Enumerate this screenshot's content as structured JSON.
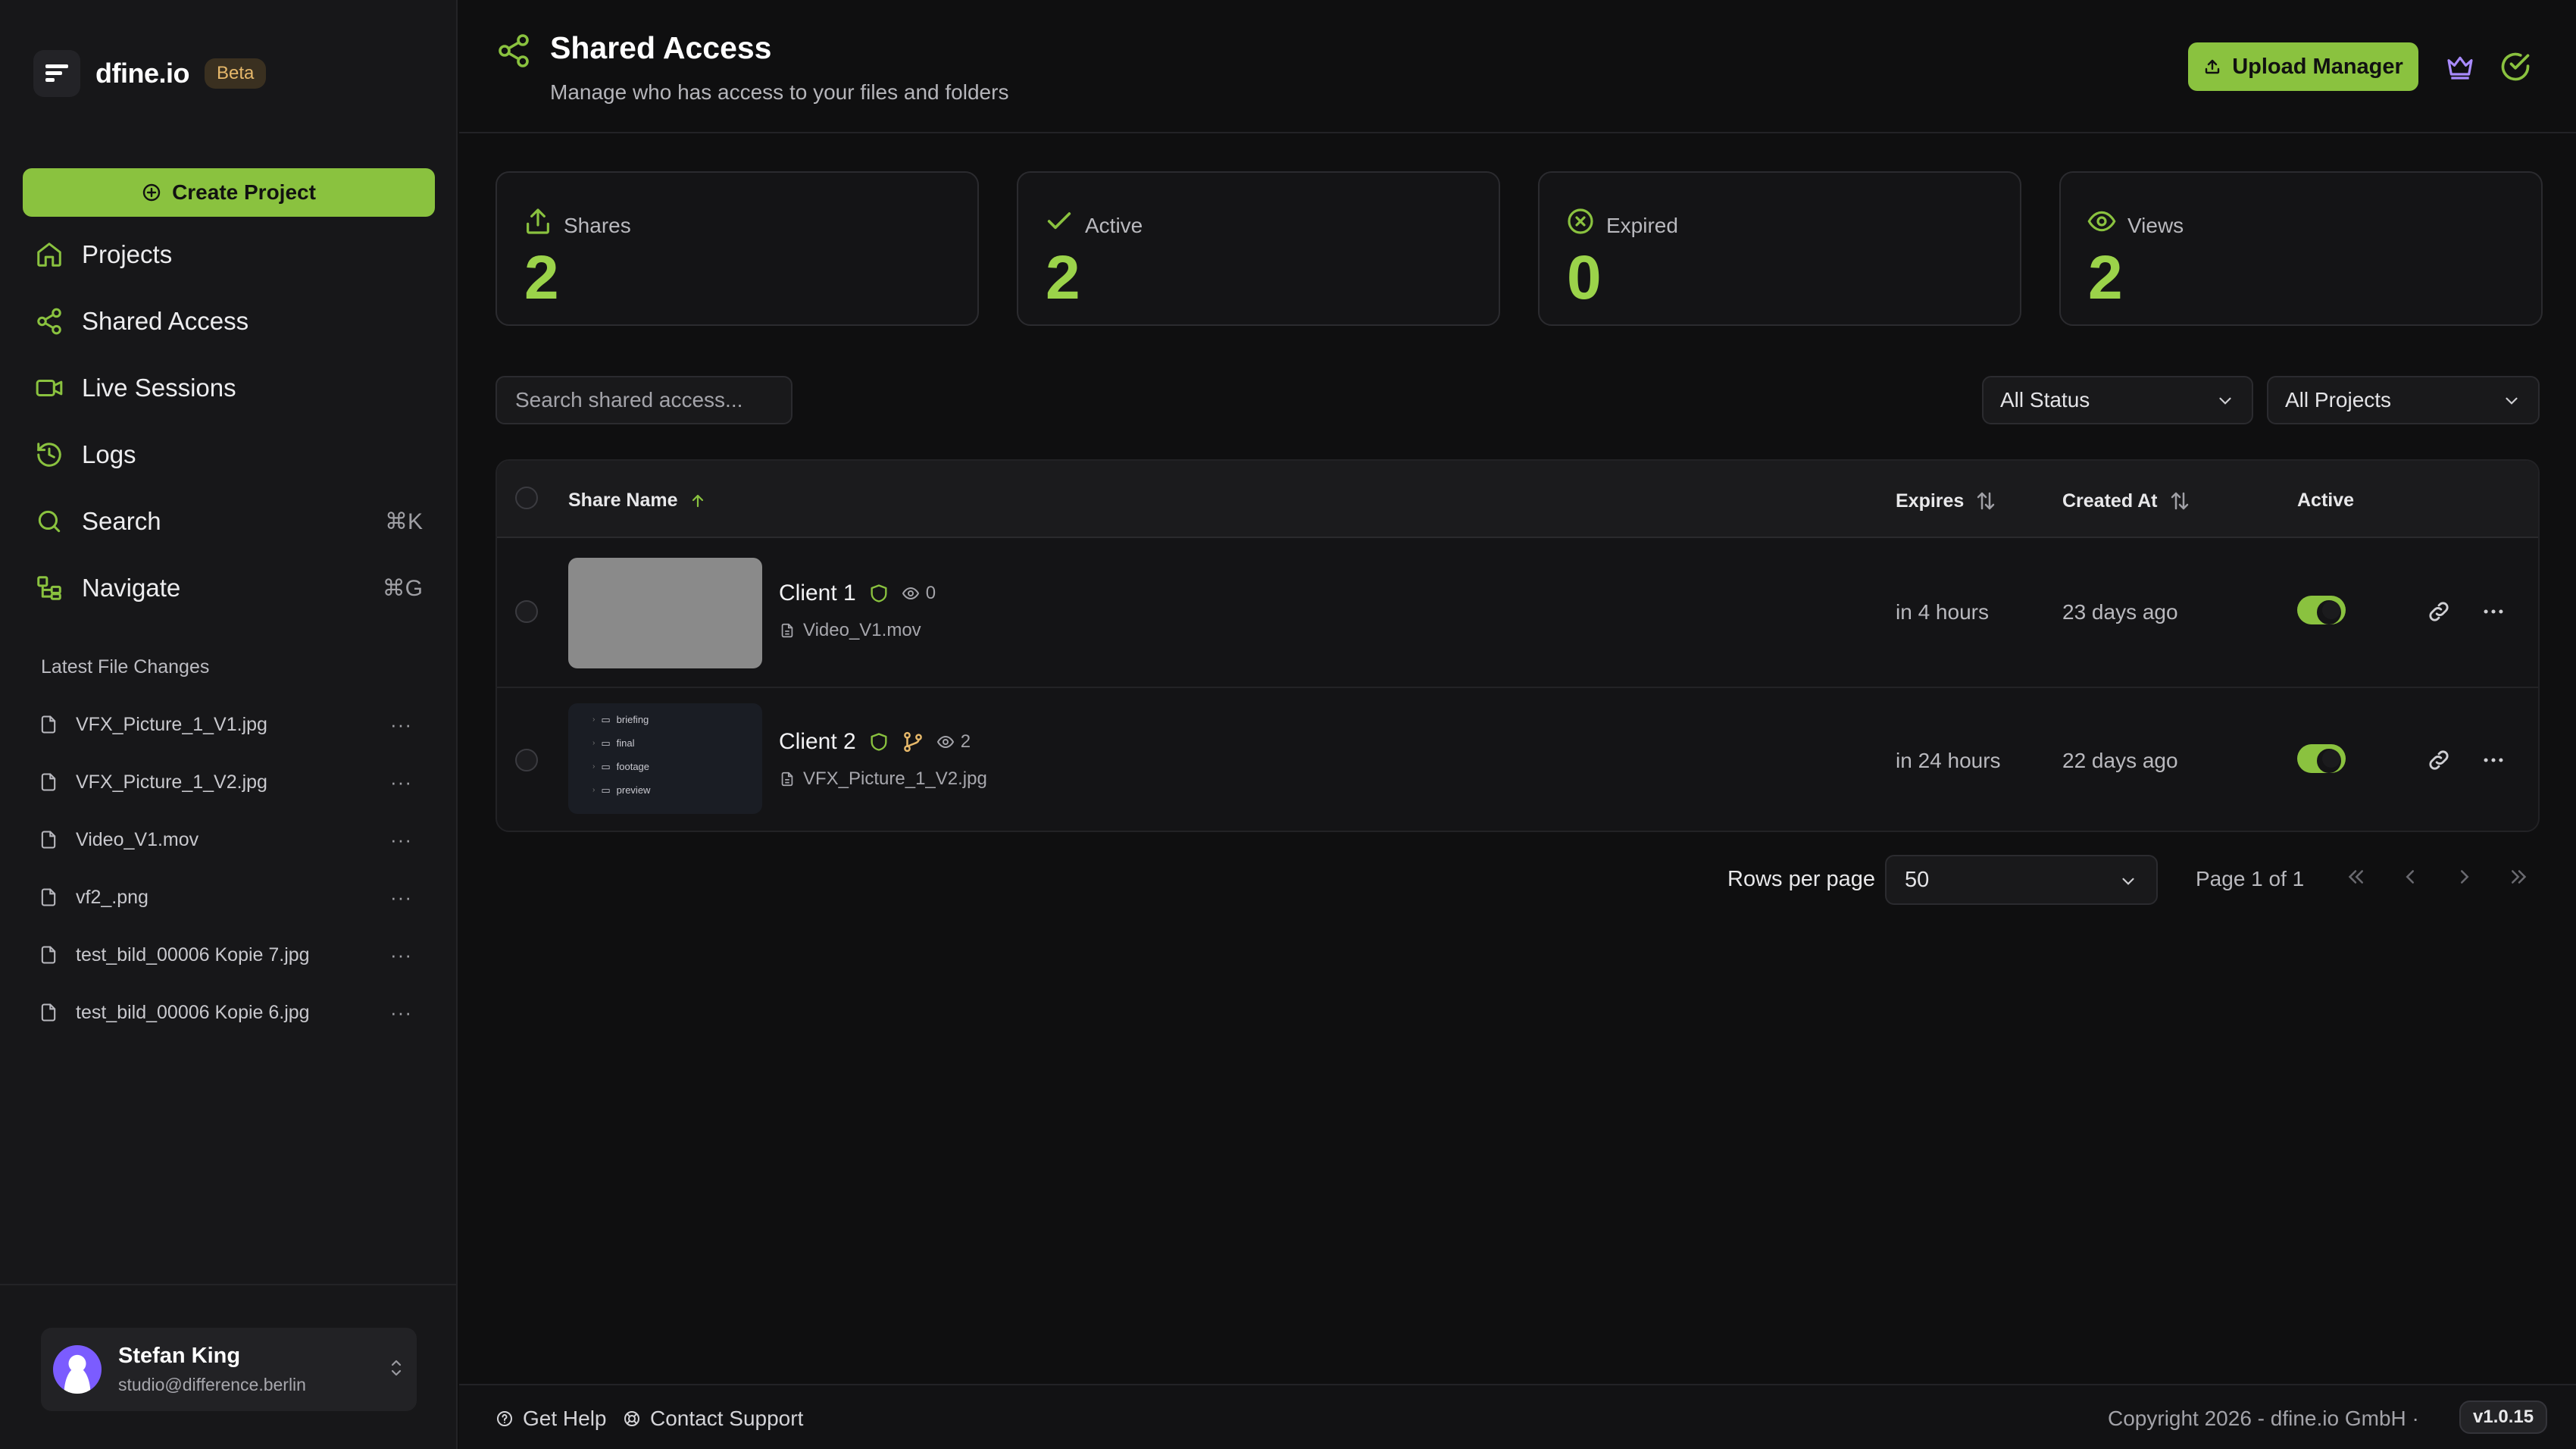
{
  "brand": {
    "name": "dfine.io",
    "badge": "Beta"
  },
  "sidebar": {
    "create_label": "Create Project",
    "nav": [
      {
        "label": "Projects",
        "icon": "home-icon",
        "shortcut": ""
      },
      {
        "label": "Shared Access",
        "icon": "share-icon",
        "shortcut": ""
      },
      {
        "label": "Live Sessions",
        "icon": "video-icon",
        "shortcut": ""
      },
      {
        "label": "Logs",
        "icon": "history-icon",
        "shortcut": ""
      },
      {
        "label": "Search",
        "icon": "search-icon",
        "shortcut": "⌘K"
      },
      {
        "label": "Navigate",
        "icon": "navigate-icon",
        "shortcut": "⌘G"
      }
    ],
    "latest_title": "Latest File Changes",
    "files": [
      "VFX_Picture_1_V1.jpg",
      "VFX_Picture_1_V2.jpg",
      "Video_V1.mov",
      "vf2_.png",
      "test_bild_00006 Kopie 7.jpg",
      "test_bild_00006 Kopie 6.jpg"
    ],
    "file_menu": "···",
    "user": {
      "name": "Stefan King",
      "email": "studio@difference.berlin"
    }
  },
  "header": {
    "title": "Shared Access",
    "subtitle": "Manage who has access to your files and folders",
    "upload_label": "Upload Manager"
  },
  "stats": [
    {
      "label": "Shares",
      "value": "2",
      "icon": "upload-icon"
    },
    {
      "label": "Active",
      "value": "2",
      "icon": "check-icon"
    },
    {
      "label": "Expired",
      "value": "0",
      "icon": "x-circle-icon"
    },
    {
      "label": "Views",
      "value": "2",
      "icon": "eye-icon"
    }
  ],
  "filters": {
    "search_placeholder": "Search shared access...",
    "status": "All Status",
    "projects": "All Projects"
  },
  "table": {
    "columns": {
      "name": "Share Name",
      "expires": "Expires",
      "created": "Created At",
      "active": "Active"
    },
    "rows": [
      {
        "name": "Client 1",
        "views": "0",
        "file": "Video_V1.mov",
        "expires": "in 4 hours",
        "created": "23 days ago",
        "active": true,
        "thumb": "gray"
      },
      {
        "name": "Client 2",
        "views": "2",
        "file": "VFX_Picture_1_V2.jpg",
        "expires": "in 24 hours",
        "created": "22 days ago",
        "active": true,
        "thumb": "tree",
        "tree": [
          "briefing",
          "final",
          "footage",
          "preview"
        ]
      }
    ]
  },
  "pagination": {
    "rows_label": "Rows per page",
    "rows_value": "50",
    "page_label": "Page 1 of 1"
  },
  "footer": {
    "help": "Get Help",
    "support": "Contact Support",
    "copyright": "Copyright 2026 - dfine.io GmbH  ·",
    "version": "v1.0.15"
  },
  "colors": {
    "accent": "#8ac23f",
    "stat_value": "#9bd34a",
    "background": "#0f0f10",
    "sidebar": "#171719"
  }
}
